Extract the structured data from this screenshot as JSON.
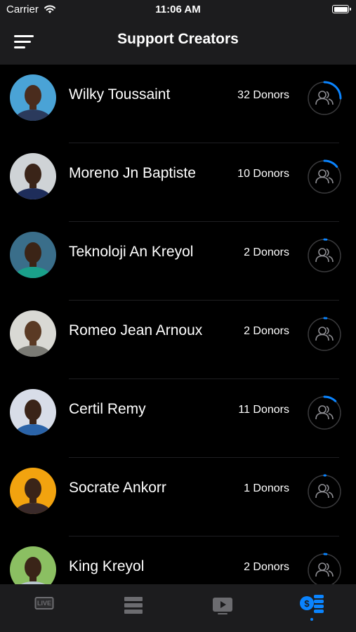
{
  "status_bar": {
    "carrier": "Carrier",
    "time": "11:06 AM"
  },
  "header": {
    "title": "Support Creators"
  },
  "creators": [
    {
      "name": "Wilky Toussaint",
      "donors": "32 Donors",
      "progress": 0.25
    },
    {
      "name": "Moreno Jn Baptiste",
      "donors": "10 Donors",
      "progress": 0.14
    },
    {
      "name": "Teknoloji An Kreyol",
      "donors": "2 Donors",
      "progress": 0.02
    },
    {
      "name": "Romeo Jean Arnoux",
      "donors": "2 Donors",
      "progress": 0.02
    },
    {
      "name": "Certil Remy",
      "donors": "11 Donors",
      "progress": 0.12
    },
    {
      "name": "Socrate Ankorr",
      "donors": "1 Donors",
      "progress": 0.01
    },
    {
      "name": "King Kreyol",
      "donors": "2 Donors",
      "progress": 0.02
    }
  ],
  "avatar_colors": [
    {
      "bg": "#4aa3d6",
      "skin": "#4a2c1d",
      "shirt": "#2b3a5c"
    },
    {
      "bg": "#cfd3d6",
      "skin": "#3a2418",
      "shirt": "#1e2d5a"
    },
    {
      "bg": "#3a6e8a",
      "skin": "#3b2416",
      "shirt": "#1aa08a"
    },
    {
      "bg": "#d9d9d4",
      "skin": "#5a3a24",
      "shirt": "#7a7a74"
    },
    {
      "bg": "#d8dde8",
      "skin": "#3a2418",
      "shirt": "#2a63a8"
    },
    {
      "bg": "#f2a30f",
      "skin": "#3a2418",
      "shirt": "#3a2a2a"
    },
    {
      "bg": "#8bbf62",
      "skin": "#3a2418",
      "shirt": "#b8c4cc"
    }
  ],
  "colors": {
    "accent": "#0a84ff",
    "ring_track": "#3a3a3c",
    "icon": "#8e8e93",
    "tab_inactive": "#6c6c70"
  },
  "tabs": [
    {
      "icon": "live-icon",
      "active": false
    },
    {
      "icon": "list-icon",
      "active": false
    },
    {
      "icon": "video-icon",
      "active": false
    },
    {
      "icon": "donate-icon",
      "active": true
    }
  ]
}
